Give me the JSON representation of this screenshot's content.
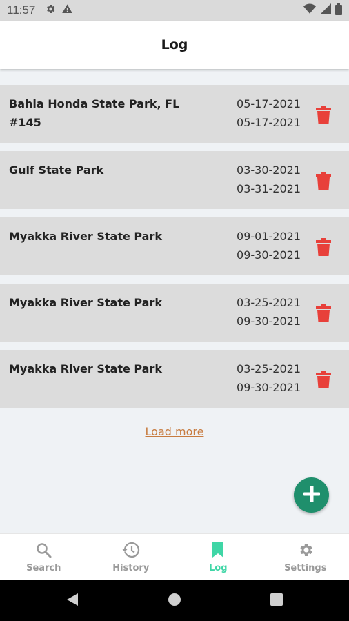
{
  "status_bar": {
    "time": "11:57",
    "left_icons": [
      "gear-icon",
      "warning-icon"
    ],
    "right_icons": [
      "wifi-icon",
      "signal-icon",
      "battery-icon"
    ]
  },
  "header": {
    "title": "Log"
  },
  "log_entries": [
    {
      "name": "Bahia Honda State Park, FL #145",
      "start_date": "05-17-2021",
      "end_date": "05-17-2021"
    },
    {
      "name": "Gulf State Park",
      "start_date": "03-30-2021",
      "end_date": "03-31-2021"
    },
    {
      "name": "Myakka River State Park",
      "start_date": "09-01-2021",
      "end_date": "09-30-2021"
    },
    {
      "name": "Myakka River State Park",
      "start_date": "03-25-2021",
      "end_date": "09-30-2021"
    },
    {
      "name": "Myakka River State Park",
      "start_date": "03-25-2021",
      "end_date": "09-30-2021"
    }
  ],
  "load_more_label": "Load more",
  "fab": {
    "icon": "plus-icon"
  },
  "bottom_nav": {
    "items": [
      {
        "label": "Search",
        "icon": "search-icon",
        "active": false
      },
      {
        "label": "History",
        "icon": "history-icon",
        "active": false
      },
      {
        "label": "Log",
        "icon": "bookmark-icon",
        "active": true
      },
      {
        "label": "Settings",
        "icon": "gear-icon",
        "active": false
      }
    ]
  },
  "colors": {
    "accent": "#3fd6a6",
    "fab": "#1f8f6c",
    "delete": "#e8403a",
    "link": "#c77b3f",
    "row_background": "#dcdcdc"
  }
}
